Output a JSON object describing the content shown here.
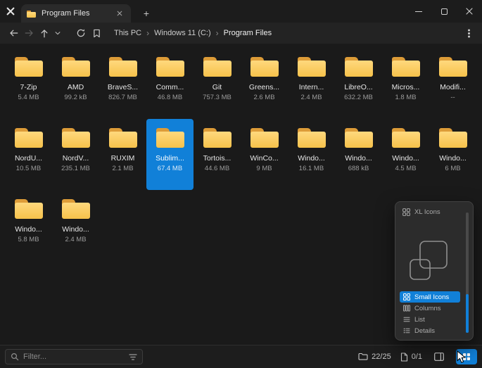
{
  "titlebar": {
    "tab_title": "Program Files",
    "new_tab_label": "+"
  },
  "toolbar": {
    "breadcrumb": [
      "This PC",
      "Windows 11 (C:)",
      "Program Files"
    ],
    "separator": "›"
  },
  "files": [
    {
      "name": "7-Zip",
      "size": "5.4 MB",
      "selected": false
    },
    {
      "name": "AMD",
      "size": "99.2 kB",
      "selected": false
    },
    {
      "name": "BraveS...",
      "size": "826.7 MB",
      "selected": false
    },
    {
      "name": "Comm...",
      "size": "46.8 MB",
      "selected": false
    },
    {
      "name": "Git",
      "size": "757.3 MB",
      "selected": false
    },
    {
      "name": "Greens...",
      "size": "2.6 MB",
      "selected": false
    },
    {
      "name": "Intern...",
      "size": "2.4 MB",
      "selected": false
    },
    {
      "name": "LibreO...",
      "size": "632.2 MB",
      "selected": false
    },
    {
      "name": "Micros...",
      "size": "1.8 MB",
      "selected": false
    },
    {
      "name": "Modifi...",
      "size": "--",
      "selected": false
    },
    {
      "name": "NordU...",
      "size": "10.5 MB",
      "selected": false
    },
    {
      "name": "NordV...",
      "size": "235.1 MB",
      "selected": false
    },
    {
      "name": "RUXIM",
      "size": "2.1 MB",
      "selected": false
    },
    {
      "name": "Sublim...",
      "size": "67.4 MB",
      "selected": true
    },
    {
      "name": "Tortois...",
      "size": "44.6 MB",
      "selected": false
    },
    {
      "name": "WinCo...",
      "size": "9 MB",
      "selected": false
    },
    {
      "name": "Windo...",
      "size": "16.1 MB",
      "selected": false
    },
    {
      "name": "Windo...",
      "size": "688 kB",
      "selected": false
    },
    {
      "name": "Windo...",
      "size": "4.5 MB",
      "selected": false
    },
    {
      "name": "Windo...",
      "size": "6 MB",
      "selected": false
    },
    {
      "name": "Windo...",
      "size": "5.8 MB",
      "selected": false
    },
    {
      "name": "Windo...",
      "size": "2.4 MB",
      "selected": false
    }
  ],
  "layout_popup": {
    "current_label": "XL Icons",
    "options": [
      {
        "label": "Small Icons",
        "selected": true
      },
      {
        "label": "Columns",
        "selected": false
      },
      {
        "label": "List",
        "selected": false
      },
      {
        "label": "Details",
        "selected": false
      }
    ]
  },
  "statusbar": {
    "filter_placeholder": "Filter...",
    "folder_count": "22/25",
    "file_count": "0/1"
  },
  "colors": {
    "accent": "#1180d8",
    "folder_front": "#f6c24b",
    "folder_back": "#dd9c38"
  }
}
